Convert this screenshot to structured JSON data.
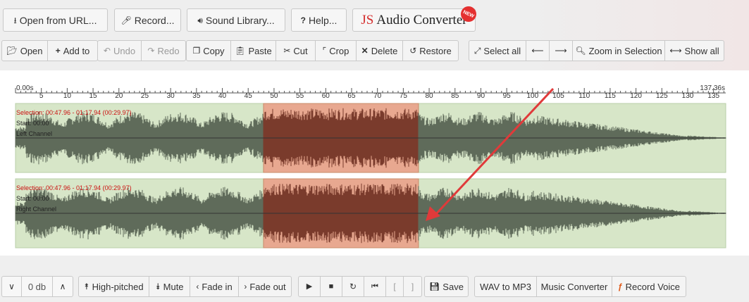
{
  "top_buttons": {
    "open_url": "Open from URL...",
    "record": "Record...",
    "sound_library": "Sound Library...",
    "help": "Help..."
  },
  "logo": {
    "js": "JS",
    "name": "Audio Converter",
    "badge": "NEW"
  },
  "edit_toolbar": {
    "open": "Open",
    "add_to": "Add to",
    "undo": "Undo",
    "redo": "Redo",
    "copy": "Copy",
    "paste": "Paste",
    "cut": "Cut",
    "crop": "Crop",
    "delete": "Delete",
    "restore": "Restore",
    "select_all": "Select all",
    "zoom_in_selection": "Zoom in Selection",
    "show_all": "Show all"
  },
  "timeline": {
    "start_label": "0.00s",
    "end_label": "137.36s",
    "ticks": [
      "5",
      "10",
      "15",
      "20",
      "25",
      "30",
      "35",
      "40",
      "45",
      "50",
      "55",
      "60",
      "65",
      "70",
      "75",
      "80",
      "85",
      "90",
      "95",
      "100",
      "105",
      "110",
      "115",
      "120",
      "125",
      "130",
      "135"
    ]
  },
  "channels": [
    {
      "selection": "Selection: 00:47.96 - 01:17.94 (00:29.97)",
      "start": "Start: 00:00",
      "name": "Left Channel"
    },
    {
      "selection": "Selection: 00:47.96 - 01:17.94 (00:29.97)",
      "start": "Start: 00:00",
      "name": "Right Channel"
    }
  ],
  "selection_range": {
    "start_s": 47.96,
    "end_s": 77.94,
    "total_s": 137.36
  },
  "bottom_toolbar": {
    "volume": "0 db",
    "high_pitched": "High-pitched",
    "mute": "Mute",
    "fade_in": "Fade in",
    "fade_out": "Fade out",
    "save": "Save",
    "wav_to_mp3": "WAV to MP3",
    "music_converter": "Music Converter",
    "record_voice": "Record Voice"
  },
  "colors": {
    "track_bg": "#d7e6c8",
    "waveform": "#5f6b5a",
    "selection_fill": "#e8a890",
    "selection_wave": "#7a3b2c",
    "selection_text": "#cc1111",
    "arrow": "#e03a3a"
  }
}
